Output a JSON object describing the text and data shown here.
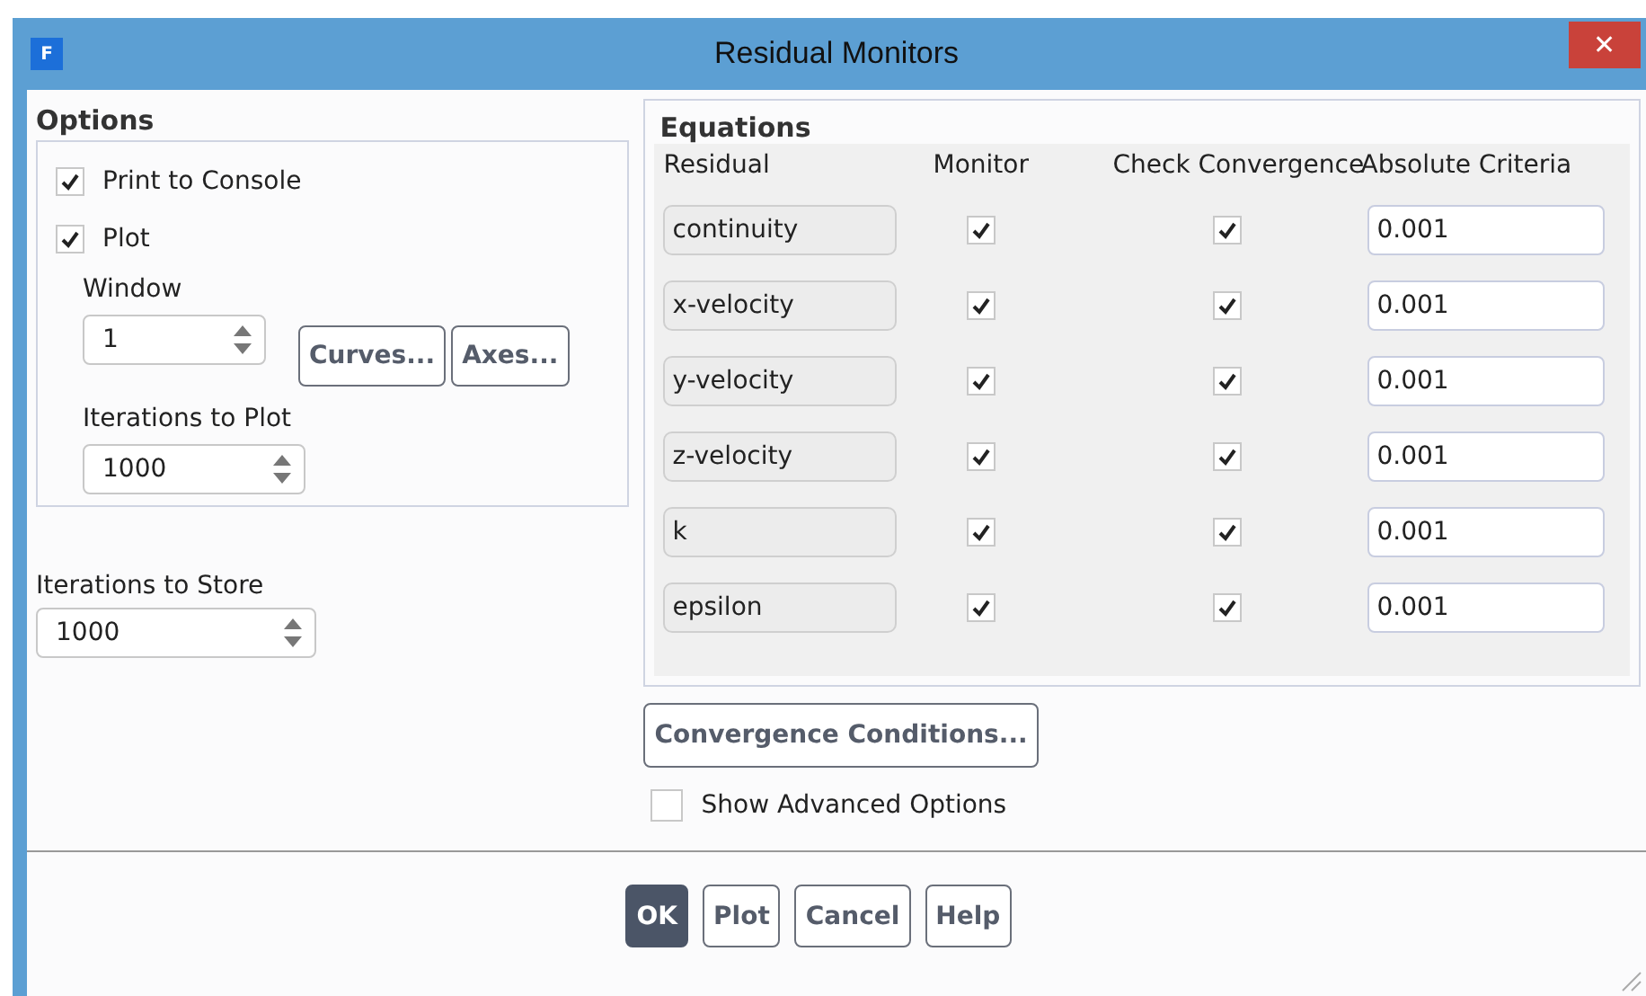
{
  "window": {
    "title": "Residual Monitors",
    "logo": "F",
    "close": "✕"
  },
  "options": {
    "title": "Options",
    "checks": [
      {
        "label": "Print to Console",
        "checked": true
      },
      {
        "label": "Plot",
        "checked": true
      }
    ],
    "window_label": "Window",
    "window_value": "1",
    "buttons": [
      "Curves...",
      "Axes..."
    ],
    "iterations_plot_label": "Iterations to Plot",
    "iterations_plot_value": "1000"
  },
  "iterations_store": {
    "label": "Iterations to Store",
    "value": "1000"
  },
  "equations": {
    "title": "Equations",
    "columns": [
      "Residual",
      "Monitor",
      "Check Convergence",
      "Absolute Criteria"
    ],
    "rows": [
      {
        "residual": "continuity",
        "monitor": true,
        "check": true,
        "criteria": "0.001"
      },
      {
        "residual": "x-velocity",
        "monitor": true,
        "check": true,
        "criteria": "0.001"
      },
      {
        "residual": "y-velocity",
        "monitor": true,
        "check": true,
        "criteria": "0.001"
      },
      {
        "residual": "z-velocity",
        "monitor": true,
        "check": true,
        "criteria": "0.001"
      },
      {
        "residual": "k",
        "monitor": true,
        "check": true,
        "criteria": "0.001"
      },
      {
        "residual": "epsilon",
        "monitor": true,
        "check": true,
        "criteria": "0.001"
      }
    ]
  },
  "convergence_button": "Convergence Conditions...",
  "advanced": {
    "label": "Show Advanced Options",
    "checked": false
  },
  "footer": [
    {
      "label": "OK",
      "selected": true
    },
    {
      "label": "Plot",
      "selected": false
    },
    {
      "label": "Cancel",
      "selected": false
    },
    {
      "label": "Help",
      "selected": false
    }
  ]
}
